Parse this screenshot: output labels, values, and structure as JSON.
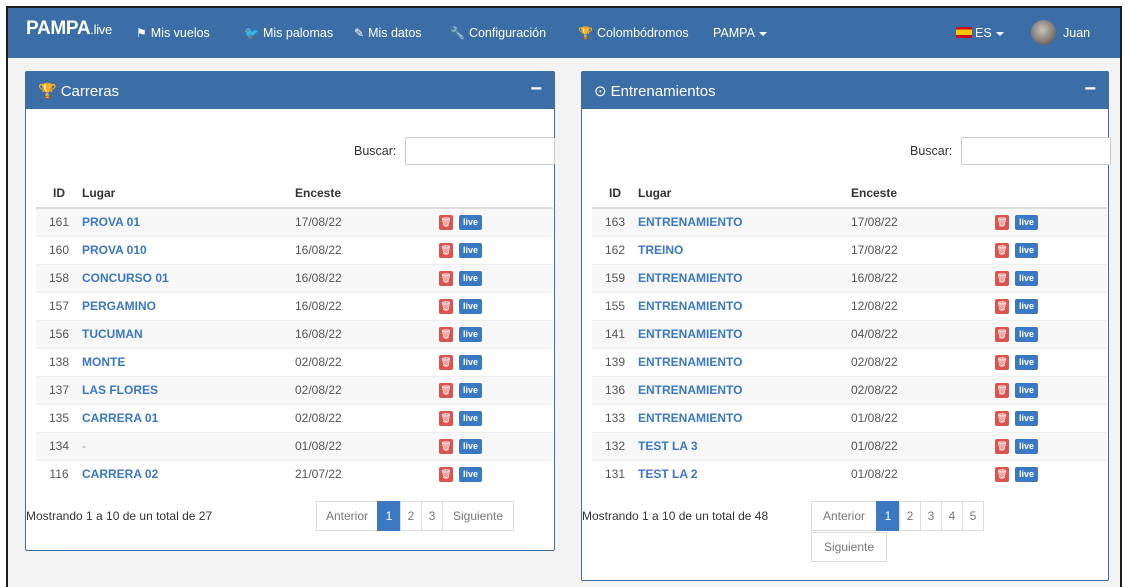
{
  "navbar": {
    "brand_main": "PAMPA",
    "brand_sub": ".live",
    "items": [
      {
        "label": "Mis vuelos",
        "icon": "flag-checkered-icon"
      },
      {
        "label": "Mis palomas",
        "icon": "twitter-bird-icon"
      },
      {
        "label": "Mis datos",
        "icon": "edit-icon"
      },
      {
        "label": "Configuración",
        "icon": "wrench-icon"
      },
      {
        "label": "Colombódromos",
        "icon": "trophy-icon"
      },
      {
        "label": "PAMPA",
        "icon": "caret-down-icon"
      }
    ],
    "language": "ES",
    "user": "Juan"
  },
  "carreras": {
    "title": "Carreras",
    "minimize": "−",
    "search_label": "Buscar:",
    "search_value": "",
    "columns": [
      "ID",
      "Lugar",
      "Enceste"
    ],
    "rows": [
      {
        "id": "161",
        "lugar": "PROVA 01",
        "enceste": "17/08/22"
      },
      {
        "id": "160",
        "lugar": "PROVA 010",
        "enceste": "16/08/22"
      },
      {
        "id": "158",
        "lugar": "CONCURSO 01",
        "enceste": "16/08/22"
      },
      {
        "id": "157",
        "lugar": "PERGAMINO",
        "enceste": "16/08/22"
      },
      {
        "id": "156",
        "lugar": "TUCUMAN",
        "enceste": "16/08/22"
      },
      {
        "id": "138",
        "lugar": "MONTE",
        "enceste": "02/08/22"
      },
      {
        "id": "137",
        "lugar": "LAS FLORES",
        "enceste": "02/08/22"
      },
      {
        "id": "135",
        "lugar": "CARRERA 01",
        "enceste": "02/08/22"
      },
      {
        "id": "134",
        "lugar": "-",
        "enceste": "01/08/22"
      },
      {
        "id": "116",
        "lugar": "CARRERA 02",
        "enceste": "21/07/22"
      }
    ],
    "live_label": "live",
    "info": "Mostrando 1 a 10 de un total de 27",
    "prev": "Anterior",
    "next": "Siguiente",
    "pages": [
      "1",
      "2",
      "3"
    ]
  },
  "entrenamientos": {
    "title": "Entrenamientos",
    "minimize": "−",
    "search_label": "Buscar:",
    "search_value": "",
    "columns": [
      "ID",
      "Lugar",
      "Enceste"
    ],
    "rows": [
      {
        "id": "163",
        "lugar": "ENTRENAMIENTO",
        "enceste": "17/08/22"
      },
      {
        "id": "162",
        "lugar": "TREINO",
        "enceste": "17/08/22"
      },
      {
        "id": "159",
        "lugar": "ENTRENAMIENTO",
        "enceste": "16/08/22"
      },
      {
        "id": "155",
        "lugar": "ENTRENAMIENTO",
        "enceste": "12/08/22"
      },
      {
        "id": "141",
        "lugar": "ENTRENAMIENTO",
        "enceste": "04/08/22"
      },
      {
        "id": "139",
        "lugar": "ENTRENAMIENTO",
        "enceste": "02/08/22"
      },
      {
        "id": "136",
        "lugar": "ENTRENAMIENTO",
        "enceste": "02/08/22"
      },
      {
        "id": "133",
        "lugar": "ENTRENAMIENTO",
        "enceste": "01/08/22"
      },
      {
        "id": "132",
        "lugar": "TEST LA 3",
        "enceste": "01/08/22"
      },
      {
        "id": "131",
        "lugar": "TEST LA 2",
        "enceste": "01/08/22"
      }
    ],
    "live_label": "live",
    "info": "Mostrando 1 a 10 de un total de 48",
    "prev": "Anterior",
    "next": "Siguiente",
    "pages": [
      "1",
      "2",
      "3",
      "4",
      "5"
    ]
  },
  "colors": {
    "primary": "#3b6da6",
    "link": "#3b78c2",
    "danger": "#d9534f"
  }
}
